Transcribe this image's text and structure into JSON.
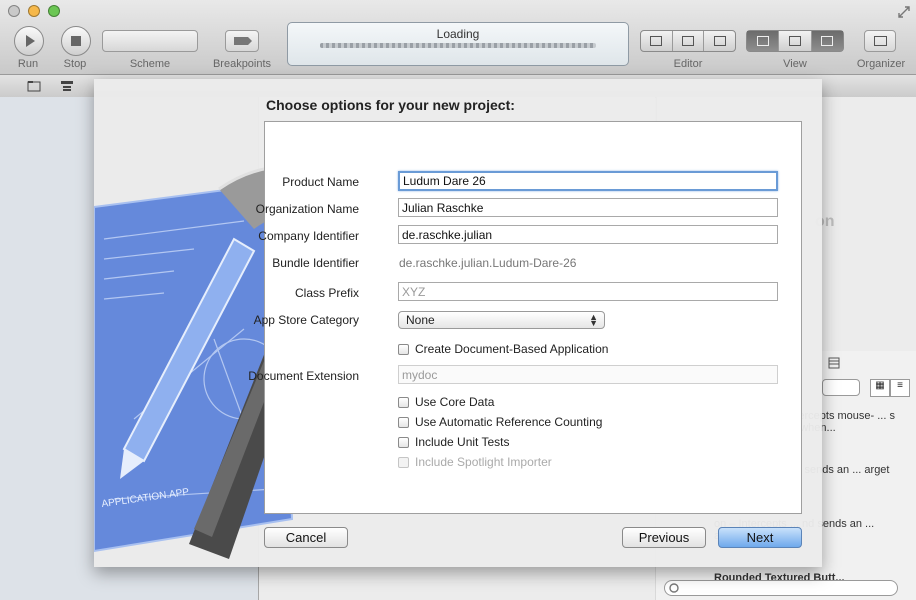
{
  "toolbar": {
    "run_label": "Run",
    "stop_label": "Stop",
    "scheme_label": "Scheme",
    "breakpoints_label": "Breakpoints",
    "activity_title": "Loading",
    "editor_label": "Editor",
    "view_label": "View",
    "organizer_label": "Organizer"
  },
  "right_pane": {
    "faded_text": "on"
  },
  "library": {
    "items": [
      {
        "text": "Push Button – Intercepts mouse- ... s an action ... oject when..."
      },
      {
        "text": "... intercepts ... nd sends an ... arget object..."
      },
      {
        "text": "on – Intercepts ... nd sends an ... arget object..."
      },
      {
        "text": "Rounded Textured Butt..."
      }
    ]
  },
  "sheet": {
    "title": "Choose options for your new project:",
    "fields": {
      "product_name_label": "Product Name",
      "product_name_value": "Ludum Dare 26",
      "organization_name_label": "Organization Name",
      "organization_name_value": "Julian Raschke",
      "company_identifier_label": "Company Identifier",
      "company_identifier_value": "de.raschke.julian",
      "bundle_identifier_label": "Bundle Identifier",
      "bundle_identifier_value": "de.raschke.julian.Ludum-Dare-26",
      "class_prefix_label": "Class Prefix",
      "class_prefix_placeholder": "XYZ",
      "app_store_category_label": "App Store Category",
      "app_store_category_value": "None",
      "document_based_label": "Create Document-Based Application",
      "document_extension_label": "Document Extension",
      "document_extension_placeholder": "mydoc",
      "use_core_data_label": "Use Core Data",
      "arc_label": "Use Automatic Reference Counting",
      "unit_tests_label": "Include Unit Tests",
      "spotlight_label": "Include Spotlight Importer"
    },
    "buttons": {
      "cancel": "Cancel",
      "previous": "Previous",
      "next": "Next"
    },
    "artwork_text": "APPLICATION.APP"
  },
  "colors": {
    "default_button": "#6fa9ec",
    "focus_ring": "#6a9bd6",
    "blueprint": "#4d78d8"
  }
}
